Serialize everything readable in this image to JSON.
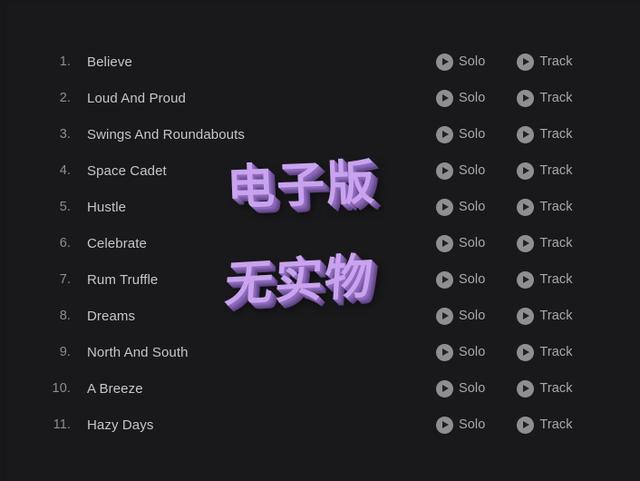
{
  "background_color": "#171719",
  "accent_color": "#c9a3ee",
  "tracks": [
    {
      "index": "1.",
      "title": "Believe"
    },
    {
      "index": "2.",
      "title": "Loud And Proud"
    },
    {
      "index": "3.",
      "title": "Swings And Roundabouts"
    },
    {
      "index": "4.",
      "title": "Space Cadet"
    },
    {
      "index": "5.",
      "title": "Hustle"
    },
    {
      "index": "6.",
      "title": "Celebrate"
    },
    {
      "index": "7.",
      "title": "Rum Truffle"
    },
    {
      "index": "8.",
      "title": "Dreams"
    },
    {
      "index": "9.",
      "title": "North And South"
    },
    {
      "index": "10.",
      "title": "A Breeze"
    },
    {
      "index": "11.",
      "title": "Hazy Days"
    }
  ],
  "actions": {
    "solo_label": "Solo",
    "track_label": "Track",
    "solo_icon": "play-circle-icon",
    "track_icon": "play-circle-icon"
  },
  "watermarks": [
    {
      "text": "电子版"
    },
    {
      "text": "无实物"
    }
  ]
}
